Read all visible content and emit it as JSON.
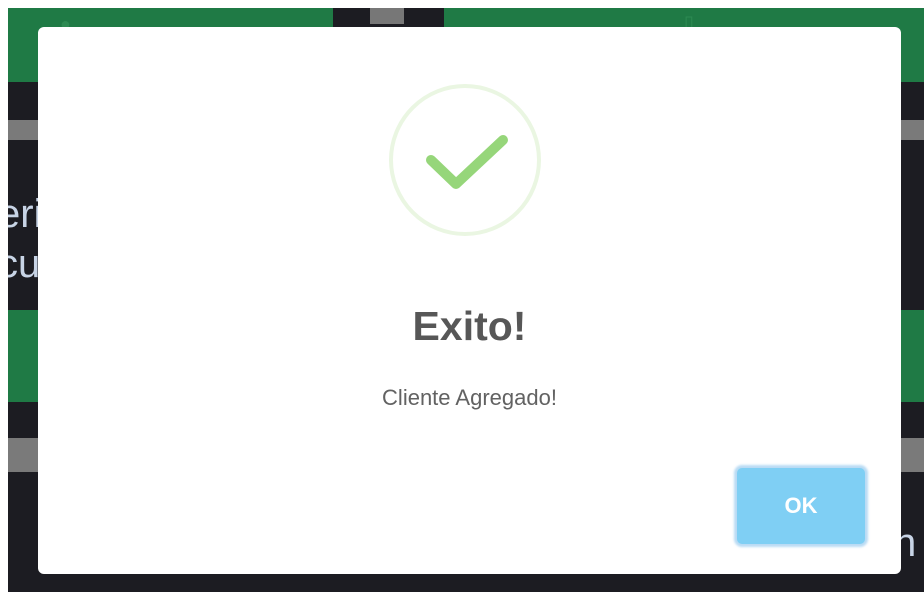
{
  "background": {
    "left_text_lines": [
      "eri",
      "cu"
    ],
    "right_text": "h"
  },
  "modal": {
    "icon": "check-circle-icon",
    "title": "Exito!",
    "message": "Cliente Agregado!",
    "ok_label": "OK",
    "colors": {
      "check": "#96d67a",
      "ring": "#eaf6e2",
      "button": "#7fcff4",
      "title": "#575757"
    }
  }
}
